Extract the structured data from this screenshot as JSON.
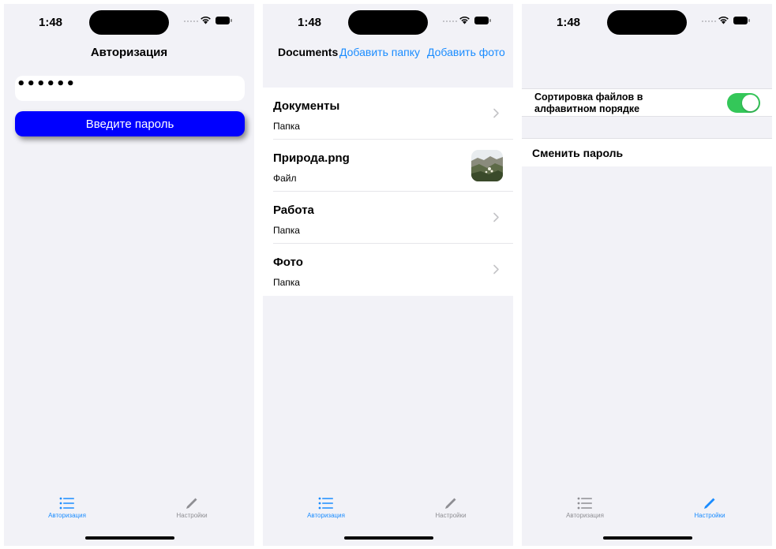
{
  "status": {
    "time": "1:48"
  },
  "auth": {
    "title": "Авторизация",
    "password_value": "••••••",
    "button_label": "Введите пароль"
  },
  "documents": {
    "title": "Documents",
    "add_folder": "Добавить папку",
    "add_photo": "Добавить фото",
    "items": [
      {
        "name": "Документы",
        "kind": "Папка",
        "accessory": "chevron-icon"
      },
      {
        "name": "Природа.png",
        "kind": "Файл",
        "accessory": "photo-thumbnail"
      },
      {
        "name": "Работа",
        "kind": "Папка",
        "accessory": "chevron-icon"
      },
      {
        "name": "Фото",
        "kind": "Папка",
        "accessory": "chevron-icon"
      }
    ]
  },
  "settings": {
    "sort_label": "Сортировка файлов в алфавитном порядке",
    "sort_enabled": true,
    "change_password": "Сменить пароль"
  },
  "tabbar": {
    "tab1_label": "Авторизация",
    "tab2_label": "Настройки",
    "tab1_icon": "list-icon",
    "tab2_icon": "pencil-icon"
  },
  "colors": {
    "accent": "#1a8cff",
    "button_blue": "#0000ff",
    "toggle_on": "#34c759",
    "background": "#f2f2f7"
  }
}
